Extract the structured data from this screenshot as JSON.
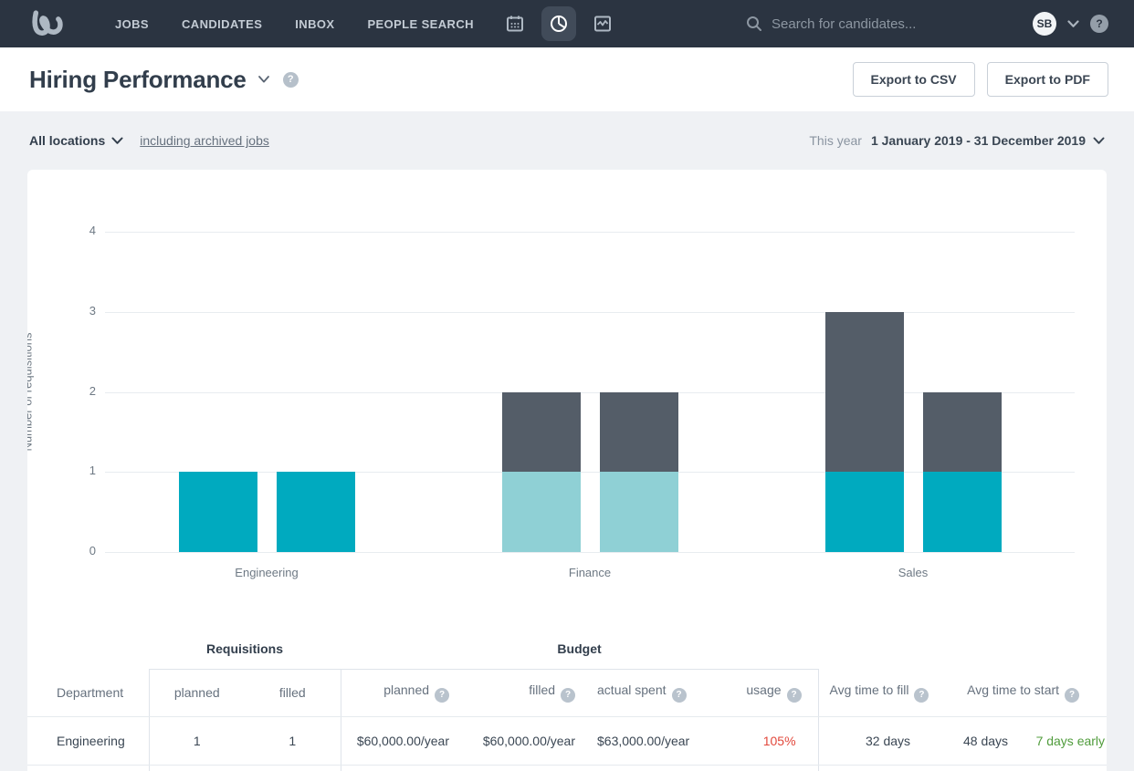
{
  "nav": {
    "menu": [
      {
        "label": "JOBS"
      },
      {
        "label": "CANDIDATES"
      },
      {
        "label": "INBOX"
      },
      {
        "label": "PEOPLE SEARCH"
      }
    ],
    "search_placeholder": "Search for candidates...",
    "avatar_initials": "SB",
    "help_glyph": "?"
  },
  "header": {
    "title": "Hiring Performance",
    "help_glyph": "?",
    "export_csv_label": "Export to CSV",
    "export_pdf_label": "Export to PDF"
  },
  "filters": {
    "location_label": "All locations",
    "archived_link_label": "including archived jobs",
    "period_label": "This year",
    "date_range": "1 January 2019 - 31 December 2019"
  },
  "chart_data": {
    "type": "bar",
    "title": "",
    "xlabel": "",
    "ylabel": "Number of requisitions",
    "ylim": [
      0,
      4
    ],
    "yticks": [
      0,
      1,
      2,
      3,
      4
    ],
    "grid": true,
    "legend": false,
    "categories": [
      "Engineering",
      "Finance",
      "Sales"
    ],
    "colors": {
      "teal": "#00aabf",
      "light_teal": "#8fd0d5",
      "slate": "#545d68"
    },
    "bars": [
      {
        "category": "Engineering",
        "slot": 0,
        "segments": [
          {
            "color": "teal",
            "value": 1
          }
        ]
      },
      {
        "category": "Engineering",
        "slot": 1,
        "segments": [
          {
            "color": "teal",
            "value": 1
          }
        ]
      },
      {
        "category": "Finance",
        "slot": 0,
        "segments": [
          {
            "color": "light_teal",
            "value": 1
          },
          {
            "color": "slate",
            "value": 1
          }
        ]
      },
      {
        "category": "Finance",
        "slot": 1,
        "segments": [
          {
            "color": "light_teal",
            "value": 1
          },
          {
            "color": "slate",
            "value": 1
          }
        ]
      },
      {
        "category": "Sales",
        "slot": 0,
        "segments": [
          {
            "color": "teal",
            "value": 1
          },
          {
            "color": "slate",
            "value": 2
          }
        ]
      },
      {
        "category": "Sales",
        "slot": 1,
        "segments": [
          {
            "color": "teal",
            "value": 1
          },
          {
            "color": "slate",
            "value": 1
          }
        ]
      }
    ]
  },
  "table": {
    "group_headers": {
      "requisitions": "Requisitions",
      "budget": "Budget"
    },
    "columns": {
      "department": "Department",
      "req_planned": "planned",
      "req_filled": "filled",
      "budget_planned": "planned",
      "budget_filled": "filled",
      "actual_spent": "actual spent",
      "usage": "usage",
      "avg_time_to_fill": "Avg time to fill",
      "avg_time_to_start": "Avg time to start"
    },
    "help_glyph": "?",
    "rows": [
      {
        "department": "Engineering",
        "req_planned": "1",
        "req_filled": "1",
        "budget_planned": "$60,000.00/year",
        "budget_filled": "$60,000.00/year",
        "actual_spent": "$63,000.00/year",
        "usage": "105%",
        "avg_time_to_fill": "32 days",
        "avg_time_to_start": "48 days",
        "start_note": "7 days early"
      }
    ]
  },
  "colors": {
    "nav_bg": "#2b3441",
    "accent_teal": "#00aabf",
    "light_teal": "#8fd0d5",
    "slate_bar": "#545d68",
    "usage_red": "#e2483c",
    "note_green": "#509c3c"
  }
}
